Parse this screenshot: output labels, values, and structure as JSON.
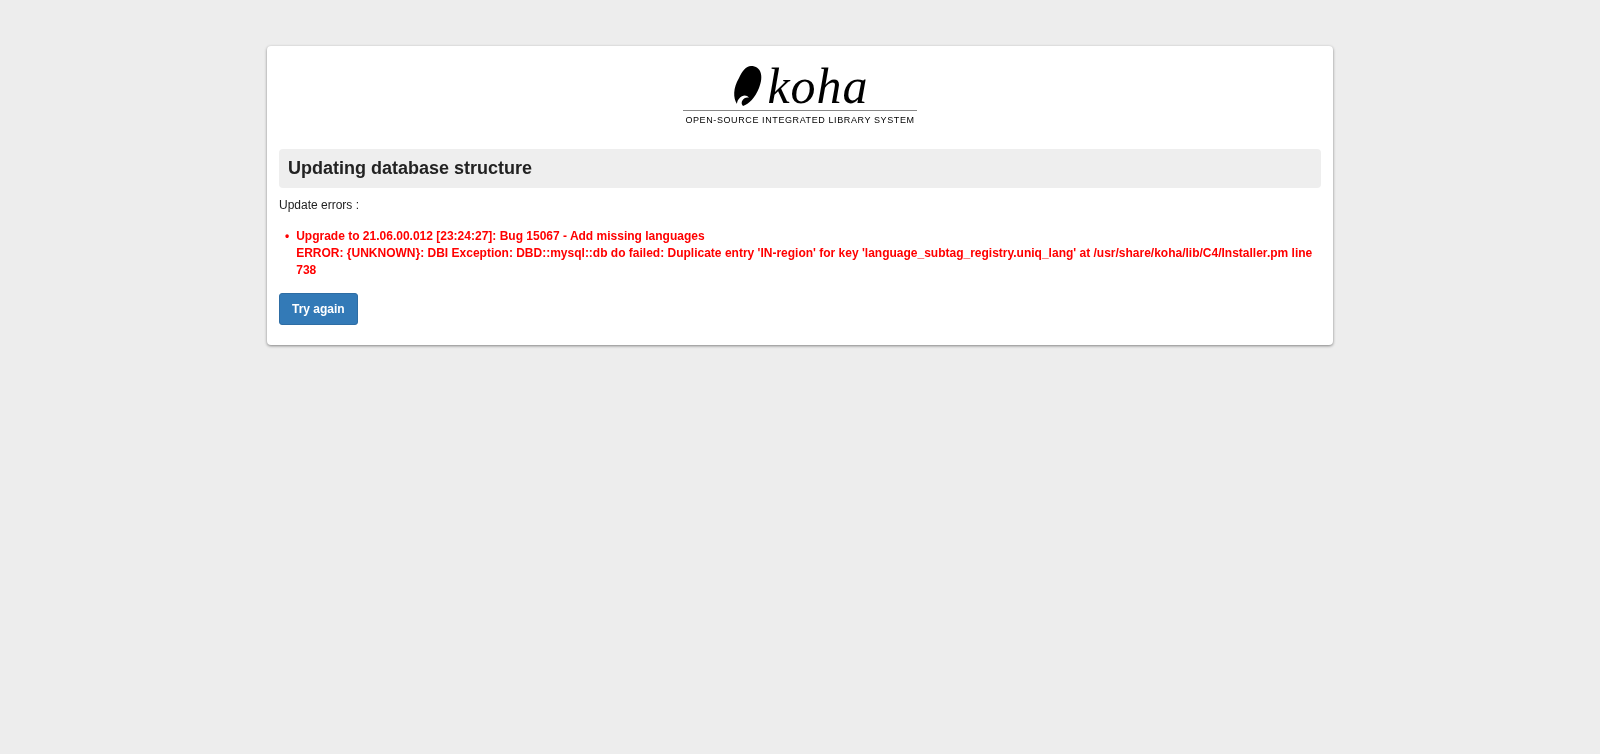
{
  "logo": {
    "wordmark": "koha",
    "tagline": "OPEN-SOURCE INTEGRATED LIBRARY SYSTEM"
  },
  "heading": "Updating database structure",
  "intro": "Update errors :",
  "errors": [
    {
      "bullet": "•",
      "title": "Upgrade to 21.06.00.012 [23:24:27]: Bug 15067 - Add missing languages",
      "message": "ERROR: {UNKNOWN}: DBI Exception: DBD::mysql::db do failed: Duplicate entry 'IN-region' for key 'language_subtag_registry.uniq_lang' at /usr/share/koha/lib/C4/Installer.pm line 738"
    }
  ],
  "buttons": [
    {
      "label": "Try again"
    }
  ]
}
